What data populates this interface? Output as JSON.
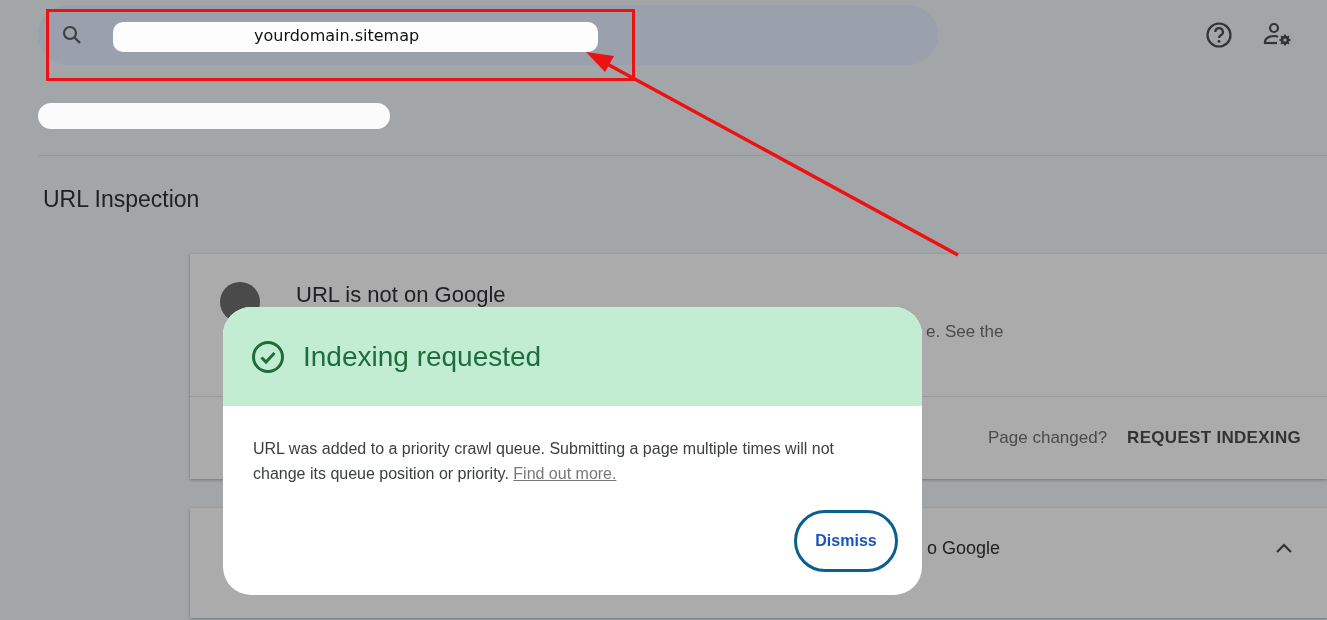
{
  "search": {
    "value": "yourdomain.sitemap"
  },
  "page_title": "URL Inspection",
  "status_card": {
    "title": "URL is not on Google",
    "description": "e. See the",
    "question": "Page changed?",
    "action": "REQUEST INDEXING"
  },
  "second_card": {
    "title": "o Google",
    "expanded": true
  },
  "dialog": {
    "title": "Indexing requested",
    "message": "URL was added to a priority crawl queue. Submitting a page multiple times will not change its queue position or priority.",
    "link": "Find out more.",
    "button": "Dismiss"
  }
}
